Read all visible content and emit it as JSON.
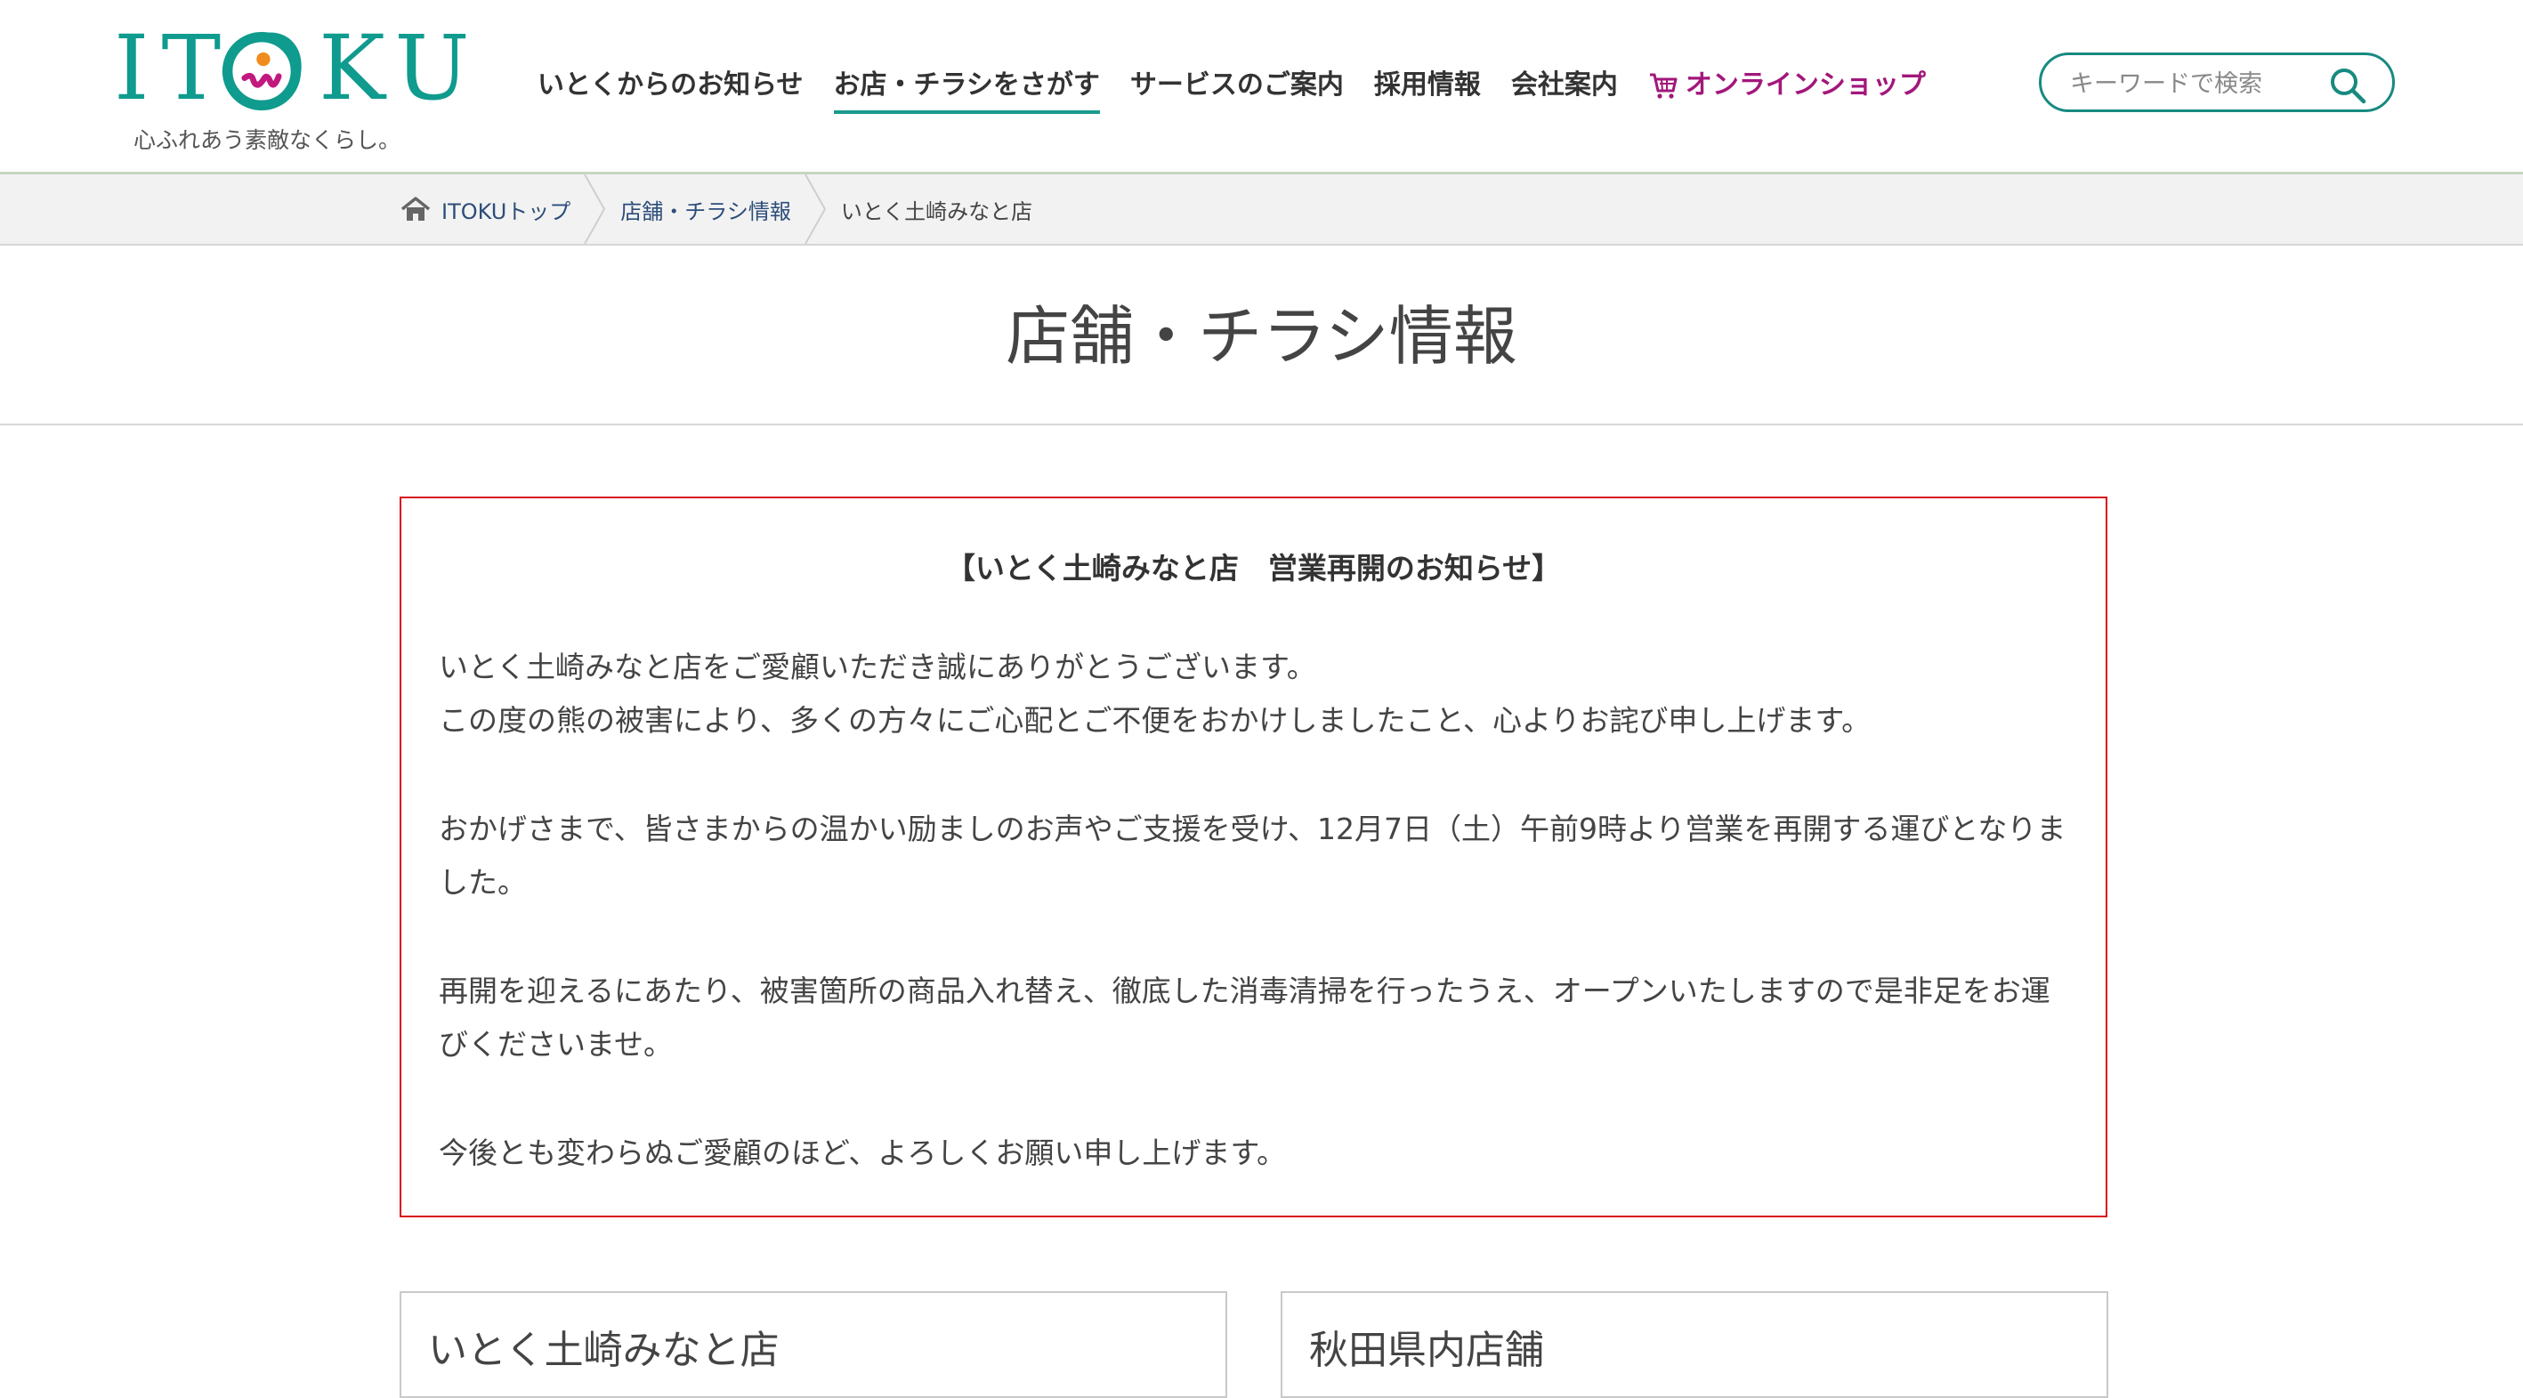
{
  "brand": {
    "logo_text": "ITOKU",
    "tagline": "心ふれあう素敵なくらし。",
    "colors": {
      "teal": "#0f9b8e",
      "orange": "#f08c1f",
      "magenta": "#a2177b",
      "notice_border": "#d7111b"
    }
  },
  "nav": {
    "items": [
      {
        "label": "いとくからのお知らせ",
        "active": false
      },
      {
        "label": "お店・チラシをさがす",
        "active": true
      },
      {
        "label": "サービスのご案内",
        "active": false
      },
      {
        "label": "採用情報",
        "active": false
      },
      {
        "label": "会社案内",
        "active": false
      }
    ],
    "shop": {
      "label": "オンラインショップ",
      "icon": "cart-icon"
    }
  },
  "search": {
    "placeholder": "キーワードで検索",
    "icon": "search-icon"
  },
  "breadcrumb": {
    "home_icon": "home-icon",
    "items": [
      "ITOKUトップ",
      "店舗・チラシ情報",
      "いとく土崎みなと店"
    ]
  },
  "page": {
    "title": "店舗・チラシ情報"
  },
  "notice": {
    "title": "【いとく土崎みなと店　営業再開のお知らせ】",
    "paragraphs": [
      "いとく土崎みなと店をご愛顧いただき誠にありがとうございます。\nこの度の熊の被害により、多くの方々にご心配とご不便をおかけしましたこと、心よりお詫び申し上げます。",
      "おかげさまで、皆さまからの温かい励ましのお声やご支援を受け、12月7日（土）午前9時より営業を再開する運びとなりました。",
      "再開を迎えるにあたり、被害箇所の商品入れ替え、徹底した消毒清掃を行ったうえ、オープンいたしますので是非足をお運びくださいませ。",
      "今後とも変わらぬご愛顧のほど、よろしくお願い申し上げます。"
    ]
  },
  "cards": [
    {
      "title": "いとく土崎みなと店"
    },
    {
      "title": "秋田県内店舗"
    }
  ]
}
